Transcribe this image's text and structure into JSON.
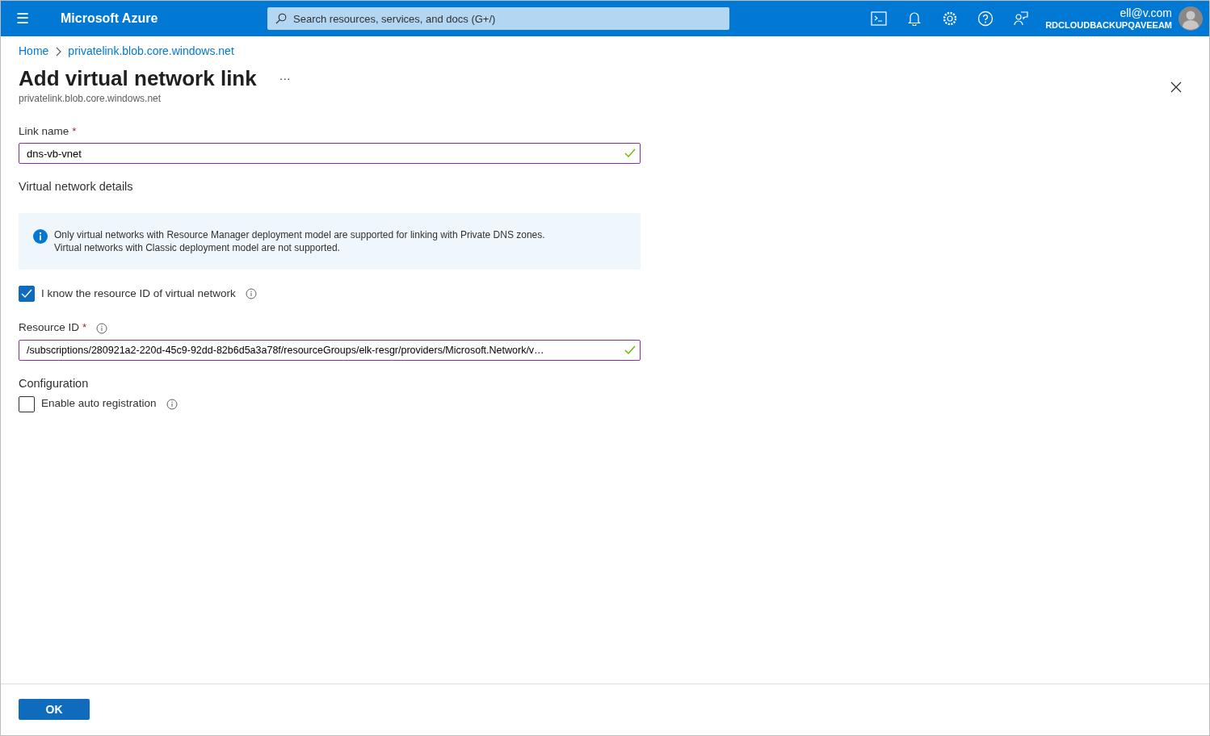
{
  "header": {
    "menu": "☰",
    "brand": "Microsoft Azure",
    "search": {
      "placeholder": "Search resources, services, and docs (G+/)"
    },
    "account": {
      "email": "ell@v.com",
      "tenant": "RDCLOUDBACKUPQAVEEAM"
    }
  },
  "breadcrumb": [
    "Home",
    "privatelink.blob.core.windows.net"
  ],
  "page": {
    "title": "Add virtual network link",
    "more": "···",
    "subtitle": "privatelink.blob.core.windows.net"
  },
  "form": {
    "link_name": {
      "label": "Link name",
      "required_mark": "*",
      "value": "dns-vb-vnet",
      "valid": true
    },
    "section": "Virtual network details",
    "info": [
      "Only virtual networks with Resource Manager deployment model are supported for linking with Private DNS zones.",
      "Virtual networks with Classic deployment model are not supported."
    ],
    "know_id": {
      "label": "I know the resource ID of virtual network",
      "checked": true
    },
    "resource_id": {
      "label": "Resource ID",
      "required_mark": "*",
      "value": "/subscriptions/280921a2-220d-45c9-92dd-82b6d5a3a78f/resourceGroups/elk-resgr/providers/Microsoft.Network/v…",
      "valid": true
    },
    "configuration": "Configuration",
    "auto_registration": {
      "label": "Enable auto registration",
      "checked": false
    }
  },
  "footer": {
    "ok": "OK"
  }
}
